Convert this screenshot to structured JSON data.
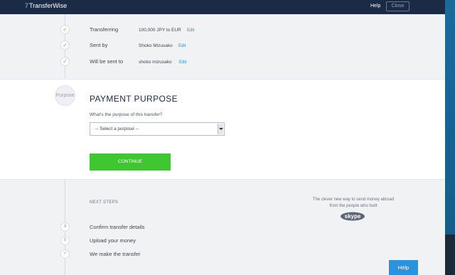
{
  "header": {
    "logo_mark": "7",
    "logo_text": "TransferWise",
    "help_label": "Help",
    "close_label": "Close"
  },
  "summary": [
    {
      "label": "Transferring",
      "value": "100,000 JPY to EUR",
      "edit": "Edit"
    },
    {
      "label": "Sent by",
      "value": "Shoko Mizusako",
      "edit": "Edit"
    },
    {
      "label": "Will be sent to",
      "value": "shoko mizusako",
      "edit": "Edit"
    }
  ],
  "purpose": {
    "step_label": "Purpose",
    "title": "PAYMENT PURPOSE",
    "question": "What's the purpose of this transfer?",
    "select_value": "-- Select a purpose --",
    "continue_label": "CONTINUE"
  },
  "next": {
    "heading": "NEXT STEPS",
    "skype_tagline_1": "The clever new way to send money abroad",
    "skype_tagline_2": "from the people who built",
    "skype_logo": "skype",
    "steps": [
      {
        "num": "4",
        "label": "Confirm transfer details"
      },
      {
        "num": "5",
        "label": "Upload your money"
      },
      {
        "num": "",
        "label": "We make the transfer"
      }
    ]
  },
  "help_button": "Help",
  "colors": {
    "header_bg": "#1b2a45",
    "continue_green": "#3fc731",
    "link_blue": "#2a8ad8",
    "help_blue": "#2a93e0",
    "check_green": "#6fbf44"
  }
}
